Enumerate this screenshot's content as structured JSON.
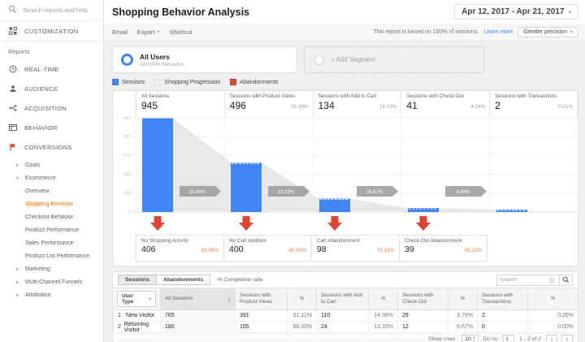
{
  "colors": {
    "blue": "#4285f4",
    "red": "#dc4632",
    "active_orange": "#e8710a",
    "pct_orange": "#e8823c",
    "link_blue": "#4285f4"
  },
  "sidebar": {
    "search_placeholder": "Search reports and help",
    "customization_label": "CUSTOMIZATION",
    "reports_label": "Reports",
    "items": [
      {
        "label": "REAL-TIME",
        "icon": "clock-icon"
      },
      {
        "label": "AUDIENCE",
        "icon": "person-icon"
      },
      {
        "label": "ACQUISITION",
        "icon": "acquisition-icon"
      },
      {
        "label": "BEHAVIOR",
        "icon": "behavior-icon"
      },
      {
        "label": "CONVERSIONS",
        "icon": "flag-icon"
      }
    ],
    "tree": [
      {
        "label": "Goals",
        "state": "collapsed",
        "children": []
      },
      {
        "label": "Ecommerce",
        "state": "expanded",
        "children": [
          "Overview",
          "Shopping Behavior",
          "Checkout Behavior",
          "Product Performance",
          "Sales Performance",
          "Product List Performance"
        ]
      },
      {
        "label": "Marketing",
        "state": "collapsed",
        "children": []
      },
      {
        "label": "Multi-Channel Funnels",
        "state": "collapsed",
        "children": []
      },
      {
        "label": "Attribution",
        "state": "collapsed",
        "children": []
      }
    ],
    "active_item": "Shopping Behavior"
  },
  "header": {
    "title": "Shopping Behavior Analysis",
    "date_range": "Apr 12, 2017 - Apr 21, 2017",
    "email_label": "Email",
    "export_label": "Export",
    "shortcut_label": "Shortcut",
    "sampling_note": "This report is based on 100% of sessions.",
    "learn_more_label": "Learn more",
    "precision_label": "Greater precision"
  },
  "segments": {
    "all_users_title": "All Users",
    "all_users_subtitle": "100.00% Sessions",
    "add_segment_label": "+ Add Segment"
  },
  "legend": [
    {
      "label": "Sessions",
      "color": "#4285f4",
      "hatched": false
    },
    {
      "label": "Shopping Progression",
      "color": "#e6e6e6",
      "hatched": true
    },
    {
      "label": "Abandonments",
      "color": "#dc4632",
      "hatched": false
    }
  ],
  "chart_data": {
    "type": "funnel",
    "title": "Shopping Behavior Analysis",
    "stages": [
      {
        "label": "All Sessions",
        "value": 945,
        "display": "945",
        "pct_of_total": ""
      },
      {
        "label": "Sessions with Product Views",
        "value": 496,
        "display": "496",
        "pct_of_total": "52.49%"
      },
      {
        "label": "Sessions with Add to Cart",
        "value": 134,
        "display": "134",
        "pct_of_total": "14.18%"
      },
      {
        "label": "Sessions with Check-Out",
        "value": 41,
        "display": "41",
        "pct_of_total": "4.34%"
      },
      {
        "label": "Sessions with Transactions",
        "value": 2,
        "display": "2",
        "pct_of_total": "0.21%"
      }
    ],
    "transitions": [
      "52.49%",
      "19.15%",
      "26.87%",
      "4.88%"
    ],
    "abandonments": [
      {
        "label": "No Shopping Activity",
        "value": 406,
        "display": "406",
        "pct": "42.96%"
      },
      {
        "label": "No Cart Addition",
        "value": 400,
        "display": "400",
        "pct": "80.65%"
      },
      {
        "label": "Cart Abandonment",
        "value": 98,
        "display": "98",
        "pct": "73.13%"
      },
      {
        "label": "Check-Out Abandonment",
        "value": 39,
        "display": "39",
        "pct": "95.12%"
      }
    ],
    "y_ticks": [
      950,
      760,
      570,
      380,
      190,
      0
    ],
    "ylim": [
      0,
      950
    ],
    "bar_color": "#4285f4",
    "wedge_color": "#e8e8e8",
    "badge_color": "#9e9e9e",
    "arrow_color": "#dc4632"
  },
  "table": {
    "tabs": [
      "Sessions",
      "Abandonments"
    ],
    "active_tab": "Sessions",
    "completion_label": "% Completion rate",
    "search_placeholder": "Search",
    "columns": [
      "User Type",
      "All Sessions",
      "Sessions with Product Views",
      "%",
      "Sessions with Add to Cart",
      "%",
      "Sessions with Check-Out",
      "%",
      "Sessions with Transactions",
      "%"
    ],
    "rows": [
      {
        "index": "1",
        "name": "New Visitor",
        "values": [
          "765",
          "391",
          "51.11%",
          "110",
          "14.38%",
          "29",
          "3.79%",
          "2",
          "0.26%"
        ]
      },
      {
        "index": "2",
        "name": "Returning Visitor",
        "values": [
          "180",
          "105",
          "58.33%",
          "24",
          "13.33%",
          "12",
          "6.67%",
          "0",
          "0.00%"
        ]
      }
    ],
    "footer": {
      "show_rows_label": "Show rows:",
      "show_rows_value": "10",
      "goto_label": "Go to:",
      "goto_value": "1",
      "range_label": "1 - 2 of 2"
    }
  }
}
